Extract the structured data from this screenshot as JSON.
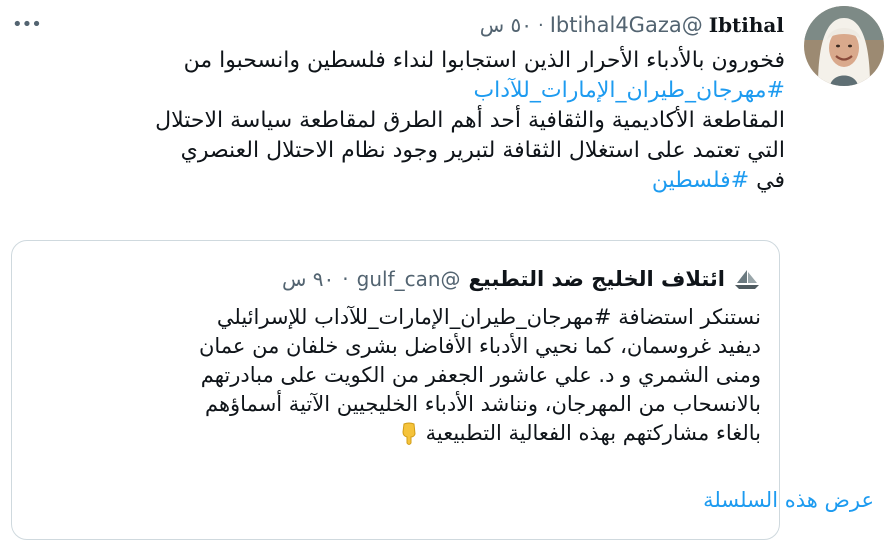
{
  "tweet": {
    "author_name": "Ibtihal",
    "handle": "@Ibtihal4Gaza",
    "separator": "·",
    "time": "٥٠ س",
    "lines": [
      "فخورون بالأدباء الأحرار الذين استجابوا لنداء فلسطين وانسحبوا من",
      "المقاطعة الأكاديمية والثقافية أحد أهم الطرق لمقاطعة سياسة الاحتلال",
      "التي تعتمد على استغلال الثقافة لتبرير وجود نظام الاحتلال العنصري"
    ],
    "hashtag_1": "#مهرجان_طيران_الإمارات_للآداب",
    "last_line_prefix": "في ",
    "hashtag_2": "#فلسطين"
  },
  "quoted": {
    "author_name": "ائتلاف الخليج ضد التطبيع",
    "handle": "@gulf_can",
    "separator": "·",
    "time": "٩٠ س",
    "lines": [
      "نستنكر استضافة #مهرجان_طيران_الإمارات_للآداب للإسرائيلي",
      "ديفيد غروسمان، كما نحيي الأدباء الأفاضل بشرى خلفان من عمان",
      "ومنى الشمري و د. علي عاشور الجعفر من الكويت على مبادرتهم",
      "بالانسحاب من المهرجان، ونناشد الأدباء الخليجيين الآتية أسماؤهم",
      "بالغاء مشاركتهم بهذه الفعالية التطبيعية"
    ],
    "emoji_icon": "backhand-index-pointing-down-icon",
    "logo_icon": "boat-logo-icon"
  },
  "show_thread_label": "عرض هذه السلسلة",
  "more_icon": "more-dots-icon",
  "colors": {
    "link": "#1d9bf0",
    "secondary_text": "#536471",
    "border": "#cfd9de"
  }
}
